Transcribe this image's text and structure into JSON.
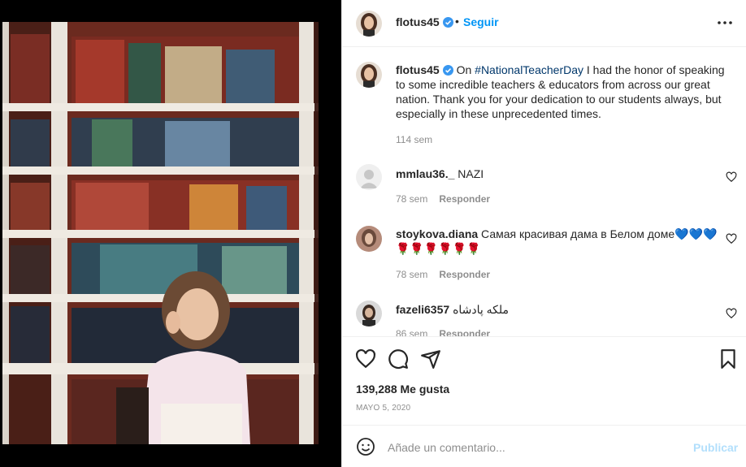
{
  "post": {
    "username": "flotus45",
    "follow_label": "Seguir",
    "separator": "•"
  },
  "caption": {
    "username": "flotus45",
    "text_before": "On ",
    "hashtag": "#NationalTeacherDay",
    "text_after": " I had the honor of speaking to some incredible teachers & educators from across our great nation. Thank you for your dedication to our students always, but especially in these unprecedented times.",
    "time": "114 sem"
  },
  "comments": [
    {
      "username": "mmlau36._",
      "text": "NAZI",
      "time": "78 sem",
      "reply_label": "Responder"
    },
    {
      "username": "stoykova.diana",
      "text": "Самая красивая дама в Белом доме💙💙💙 🌹🌹🌹🌹🌹🌹",
      "time": "78 sem",
      "reply_label": "Responder"
    },
    {
      "username": "fazeli6357",
      "text": "ملکه پادشاه",
      "time": "86 sem",
      "reply_label": "Responder"
    }
  ],
  "stats": {
    "likes": "139,288 Me gusta",
    "date": "MAYO 5, 2020"
  },
  "add_comment": {
    "placeholder": "Añade un comentario...",
    "publish_label": "Publicar"
  },
  "colors": {
    "link_blue": "#0095f6",
    "publish_disabled": "#b2dffc",
    "muted": "#8e8e8e",
    "verified": "#3897f0"
  },
  "icons": [
    "more-options-icon",
    "verified-icon",
    "heart-icon",
    "comment-icon",
    "share-icon",
    "bookmark-icon",
    "emoji-icon"
  ]
}
